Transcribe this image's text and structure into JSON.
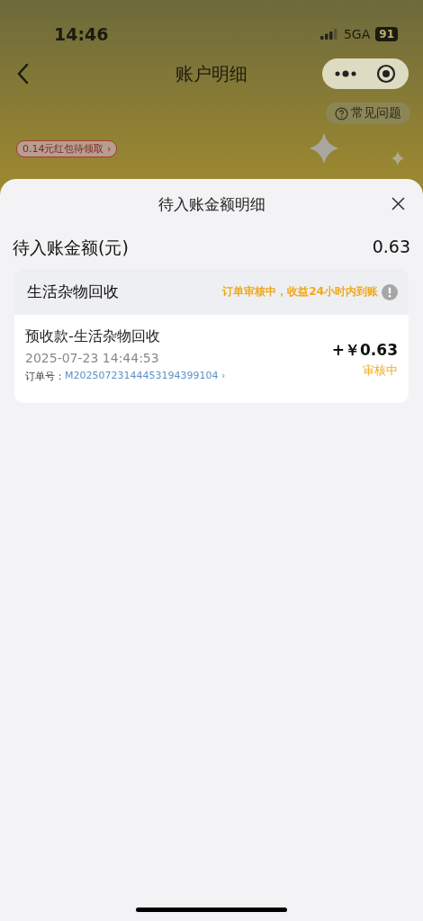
{
  "status_bar": {
    "time": "14:46",
    "network": "5GA",
    "battery": "91"
  },
  "nav_bar": {
    "title": "账户明细"
  },
  "background_page": {
    "faq_button": "常见问题",
    "red_packet_tag": "0.14元红包待领取 ›"
  },
  "sheet": {
    "title": "待入账金额明细",
    "summary_label": "待入账金额(元)",
    "summary_value": "0.63",
    "groups": [
      {
        "name": "生活杂物回收",
        "notice": "订单审核中，收益24小时内到账",
        "entries": [
          {
            "title": "预收款-生活杂物回收",
            "time": "2025-07-23 14:44:53",
            "order_label": "订单号：",
            "order_number": "M20250723144453194399104 ›",
            "amount": "+￥0.63",
            "status": "审核中"
          }
        ]
      }
    ]
  }
}
